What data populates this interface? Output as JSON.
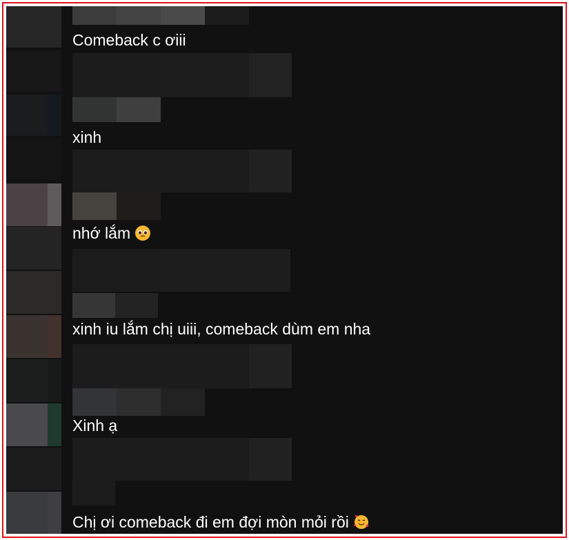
{
  "comments": [
    {
      "text": "Comeback c ơiii",
      "emoji": ""
    },
    {
      "text": "xinh",
      "emoji": ""
    },
    {
      "text": "nhớ lắm",
      "emoji": "pleading-face-icon"
    },
    {
      "text": "xinh iu lắm chị uiii, comeback dùm em nha",
      "emoji": ""
    },
    {
      "text": "Xinh ạ",
      "emoji": ""
    },
    {
      "text": "Chị ơi comeback đi em đợi mòn mỏi rồi",
      "emoji": "smiling-face-with-hearts-icon"
    }
  ],
  "colors": {
    "frame": "#e0101a",
    "background": "#111111",
    "text": "#ffffff"
  }
}
